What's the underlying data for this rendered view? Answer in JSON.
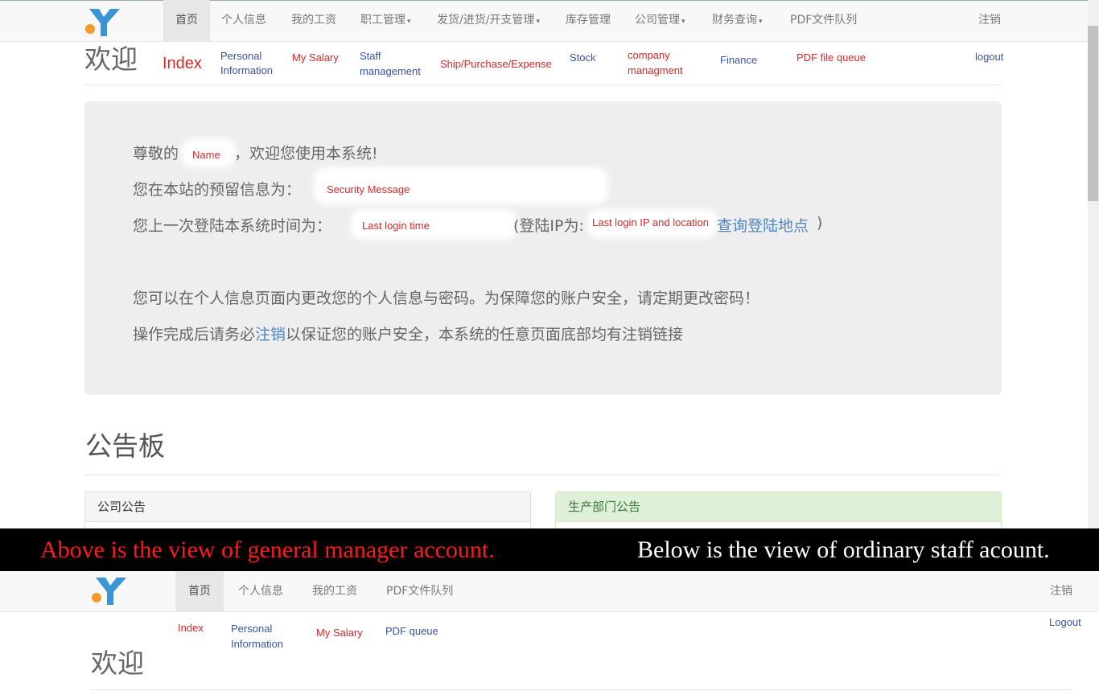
{
  "manager_view": {
    "navbar": {
      "items": [
        {
          "label": "首页",
          "dropdown": false,
          "active": true
        },
        {
          "label": "个人信息",
          "dropdown": false
        },
        {
          "label": "我的工资",
          "dropdown": false
        },
        {
          "label": "职工管理",
          "dropdown": true
        },
        {
          "label": "发货/进货/开支管理",
          "dropdown": true
        },
        {
          "label": "库存管理",
          "dropdown": false
        },
        {
          "label": "公司管理",
          "dropdown": true
        },
        {
          "label": "财务查询",
          "dropdown": true
        },
        {
          "label": "PDF文件队列",
          "dropdown": false
        }
      ],
      "logout_label": "注销",
      "caret": "▾"
    },
    "annotations": {
      "index": "Index",
      "personal_1": "Personal",
      "personal_2": "Information",
      "salary": "My Salary",
      "staff_1": "Staff",
      "staff_2": "management",
      "ship": "Ship/Purchase/Expense",
      "stock": "Stock",
      "company_1": "company",
      "company_2": "managment",
      "finance": "Finance",
      "pdf": "PDF file queue",
      "logout": "logout"
    },
    "page_title": "欢迎",
    "jumbotron": {
      "line1_prefix": "尊敬的",
      "line1_name_note": "Name",
      "line1_suffix": "，欢迎您使用本系统!",
      "line2_prefix": "您在本站的预留信息为：",
      "line2_note": "Security Message",
      "line3_prefix": "您上一次登陆本系统时间为：",
      "line3_time_note": "Last login time",
      "line3_ip_prefix": "(登陆IP为:",
      "line3_ip_note": "Last login IP and location",
      "line3_link": "查询登陆地点",
      "line3_close": ")",
      "line4": "您可以在个人信息页面内更改您的个人信息与密码。为保障您的账户安全，请定期更改密码！",
      "line5_prefix": "操作完成后请务必",
      "line5_link": "注销",
      "line5_suffix": "以保证您的账户安全，本系统的任意页面底部均有注销链接"
    },
    "board_title": "公告板",
    "panels": {
      "company": "公司公告",
      "production": "生产部门公告"
    },
    "colors": {
      "navbar_bg": "#f8f8f8",
      "jumbotron_bg": "#eeeeee",
      "success_panel_bg": "#dff0d8",
      "link": "#4d86c1"
    }
  },
  "banner": {
    "left": "Above is the view of general manager account.",
    "right": "Below is the view of ordinary staff acount."
  },
  "staff_view": {
    "navbar": {
      "items": [
        {
          "label": "首页",
          "active": true
        },
        {
          "label": "个人信息"
        },
        {
          "label": "我的工资"
        },
        {
          "label": "PDF文件队列"
        }
      ],
      "logout_label": "注销"
    },
    "annotations": {
      "index": "Index",
      "personal_1": "Personal",
      "personal_2": "Information",
      "salary": "My Salary",
      "pdf": "PDF queue",
      "logout": "Logout"
    },
    "page_title": "欢迎"
  }
}
